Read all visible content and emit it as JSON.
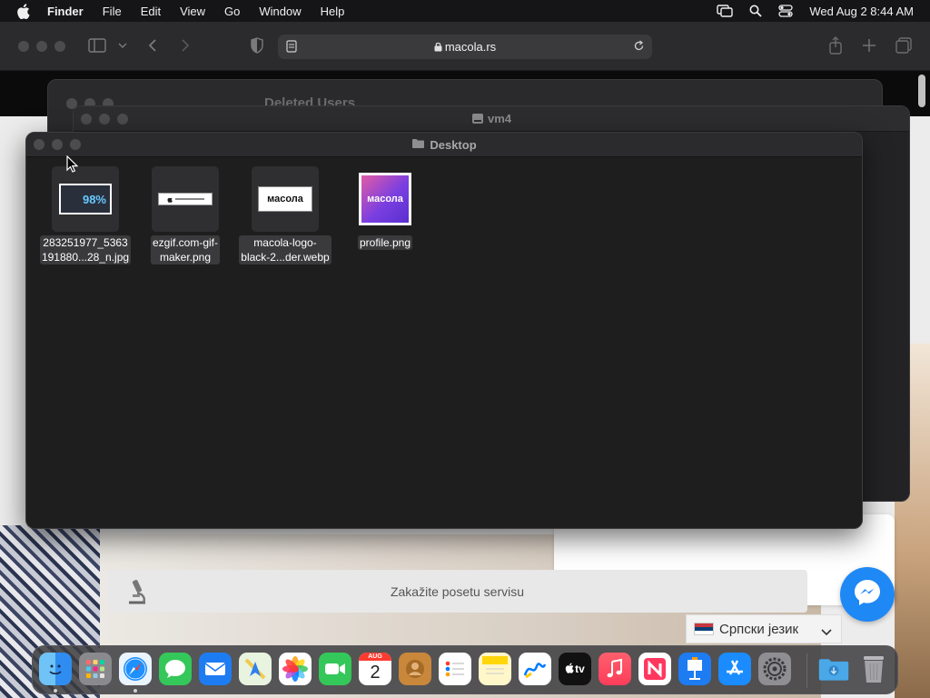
{
  "menubar": {
    "app_name": "Finder",
    "items": [
      "File",
      "Edit",
      "View",
      "Go",
      "Window",
      "Help"
    ],
    "clock": "Wed Aug 2  8:44 AM"
  },
  "safari": {
    "url": "macola.rs",
    "page": {
      "service_button": "Zakažite posetu servisu",
      "language": "Српски језик"
    }
  },
  "windows": {
    "back_title": "Deleted Users",
    "middle_title": "vm4",
    "front_title": "Desktop"
  },
  "files": [
    {
      "name_line1": "283251977_5363",
      "name_line2": "191880...28_n.jpg",
      "thumb_text": "98%"
    },
    {
      "name_line1": "ezgif.com-gif-",
      "name_line2": "maker.png",
      "thumb_text": ""
    },
    {
      "name_line1": "macola-logo-",
      "name_line2": "black-2...der.webp",
      "thumb_text": "маcола"
    },
    {
      "name_line1": "profile.png",
      "name_line2": "",
      "thumb_text": "маcола"
    }
  ],
  "dock": {
    "calendar_month": "AUG",
    "calendar_day": "2",
    "tv_label": "tv"
  }
}
